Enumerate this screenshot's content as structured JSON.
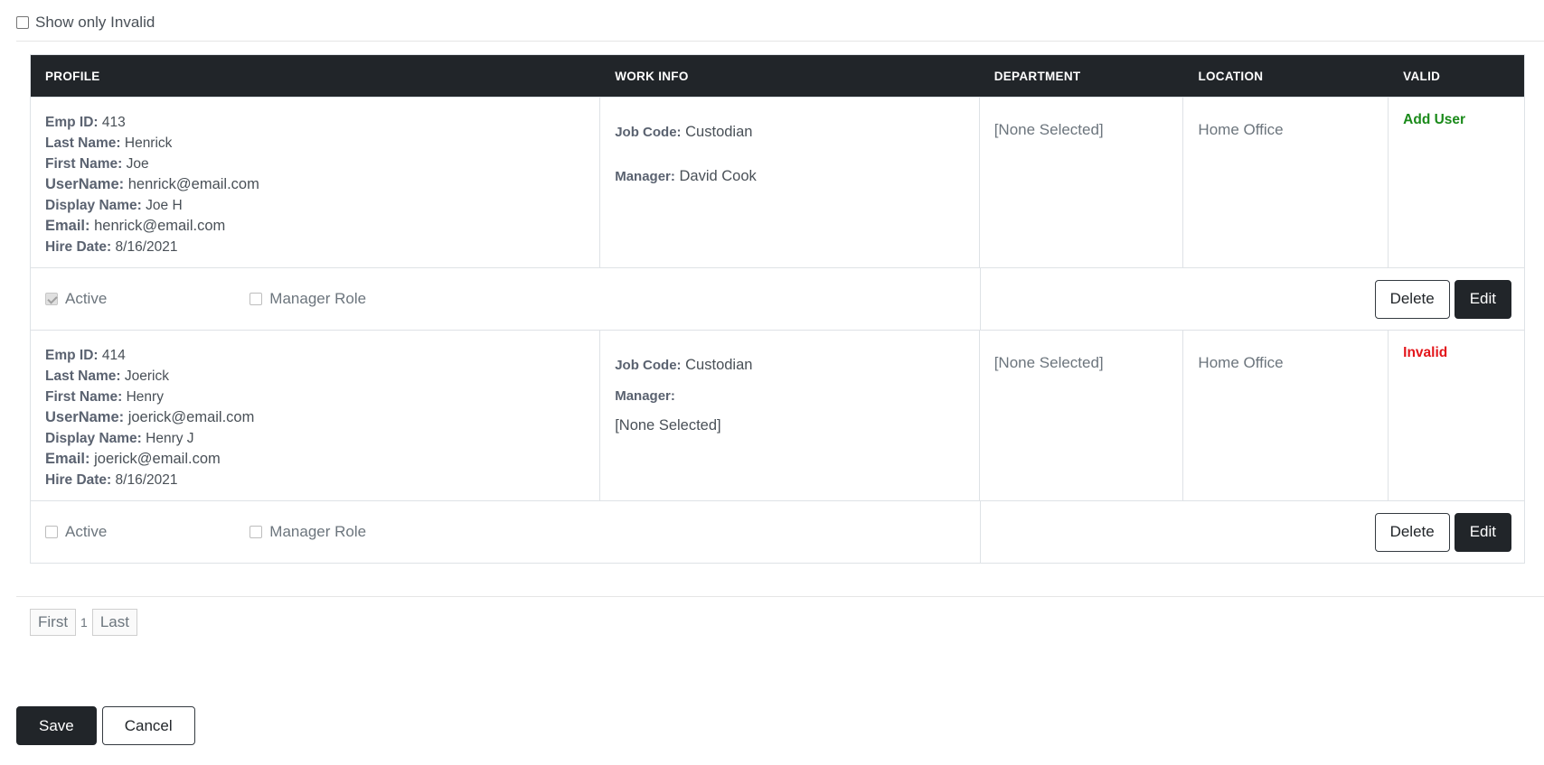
{
  "filter": {
    "label": "Show only Invalid",
    "checked": false
  },
  "table": {
    "headers": [
      "PROFILE",
      "WORK INFO",
      "DEPARTMENT",
      "LOCATION",
      "VALID"
    ],
    "rows": [
      {
        "profile": {
          "emp_id_label": "Emp ID:",
          "emp_id": "413",
          "last_name_label": "Last Name:",
          "last_name": "Henrick",
          "first_name_label": "First Name:",
          "first_name": "Joe",
          "username_label": "UserName:",
          "username": "henrick@email.com",
          "display_name_label": "Display Name:",
          "display_name": "Joe H",
          "email_label": "Email:",
          "email": "henrick@email.com",
          "hire_date_label": "Hire Date:",
          "hire_date": "8/16/2021"
        },
        "work": {
          "job_code_label": "Job Code:",
          "job_code": "Custodian",
          "manager_label": "Manager:",
          "manager": "David Cook"
        },
        "department": "[None Selected]",
        "location": "Home Office",
        "valid": "Add User",
        "active_label": "Active",
        "active_checked": true,
        "manager_role_label": "Manager Role",
        "manager_role_checked": false,
        "delete_label": "Delete",
        "edit_label": "Edit"
      },
      {
        "profile": {
          "emp_id_label": "Emp ID:",
          "emp_id": "414",
          "last_name_label": "Last Name:",
          "last_name": "Joerick",
          "first_name_label": "First Name:",
          "first_name": "Henry",
          "username_label": "UserName:",
          "username": "joerick@email.com",
          "display_name_label": "Display Name:",
          "display_name": "Henry J",
          "email_label": "Email:",
          "email": "joerick@email.com",
          "hire_date_label": "Hire Date:",
          "hire_date": "8/16/2021"
        },
        "work": {
          "job_code_label": "Job Code:",
          "job_code": "Custodian",
          "manager_label": "Manager:",
          "manager": "[None Selected]"
        },
        "department": "[None Selected]",
        "location": "Home Office",
        "valid": "Invalid",
        "active_label": "Active",
        "active_checked": false,
        "manager_role_label": "Manager Role",
        "manager_role_checked": false,
        "delete_label": "Delete",
        "edit_label": "Edit"
      }
    ]
  },
  "pager": {
    "first": "First",
    "page": "1",
    "last": "Last"
  },
  "footer": {
    "save": "Save",
    "cancel": "Cancel"
  },
  "colors": {
    "header_bg": "#212529",
    "valid_ok": "#1a8a1a",
    "invalid": "#e3161b",
    "none_selected_warn": "#ef7f86"
  }
}
